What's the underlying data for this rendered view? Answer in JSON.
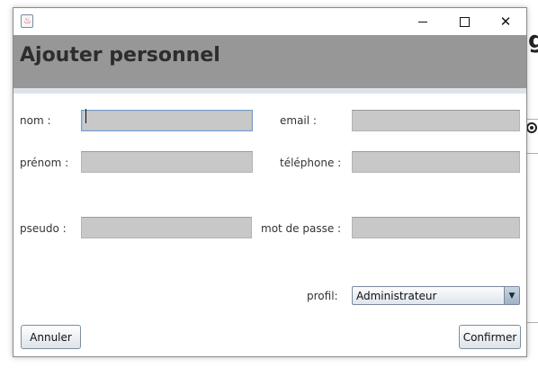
{
  "window": {
    "title": "",
    "header_title": "Ajouter personnel"
  },
  "icons": {
    "app": "java-cup-icon",
    "minimize": "minimize-icon",
    "maximize": "maximize-icon",
    "close": "close-icon"
  },
  "form": {
    "nom": {
      "label": "nom :",
      "value": ""
    },
    "email": {
      "label": "email :",
      "value": ""
    },
    "prenom": {
      "label": "prénom :",
      "value": ""
    },
    "telephone": {
      "label": "téléphone :",
      "value": ""
    },
    "pseudo": {
      "label": "pseudo :",
      "value": ""
    },
    "mot_de_passe": {
      "label": "mot de passe :",
      "value": ""
    },
    "profil": {
      "label": "profil:",
      "selected": "Administrateur"
    }
  },
  "buttons": {
    "cancel": "Annuler",
    "confirm": "Confirmer"
  },
  "background_app": {
    "heading_fragment": "g"
  },
  "colors": {
    "header_bg": "#979797",
    "field_bg": "#c8c8c8",
    "focus_border": "#7a9cc2"
  }
}
